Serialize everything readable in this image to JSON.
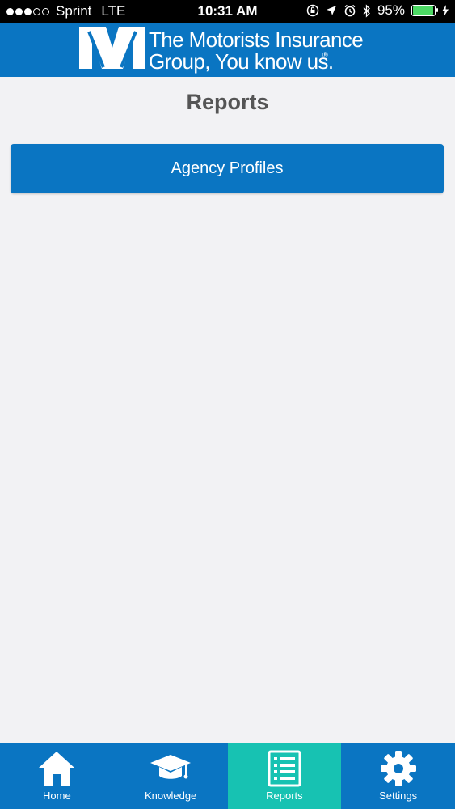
{
  "status_bar": {
    "carrier": "Sprint",
    "network": "LTE",
    "time": "10:31 AM",
    "battery_percent": "95%",
    "battery_level": 0.95,
    "signal_bars_filled": 3,
    "signal_bars_total": 5,
    "icons": [
      "lock-rotation-icon",
      "location-icon",
      "alarm-icon",
      "bluetooth-icon",
      "charging-icon"
    ]
  },
  "header": {
    "logo_line1": "The Motorists Insurance",
    "logo_line2": "Group, You know us.",
    "logo_reg": "®"
  },
  "page": {
    "title": "Reports",
    "buttons": [
      {
        "label": "Agency Profiles"
      }
    ]
  },
  "tab_bar": {
    "active_tab": "Reports",
    "tabs": [
      {
        "label": "Home",
        "icon": "home-icon"
      },
      {
        "label": "Knowledge",
        "icon": "graduation-cap-icon"
      },
      {
        "label": "Reports",
        "icon": "reports-icon"
      },
      {
        "label": "Settings",
        "icon": "gear-icon"
      }
    ]
  },
  "colors": {
    "brand_blue": "#0a75c2",
    "active_tab": "#17c2b2",
    "background": "#f2f2f4",
    "title_text": "#555555"
  }
}
